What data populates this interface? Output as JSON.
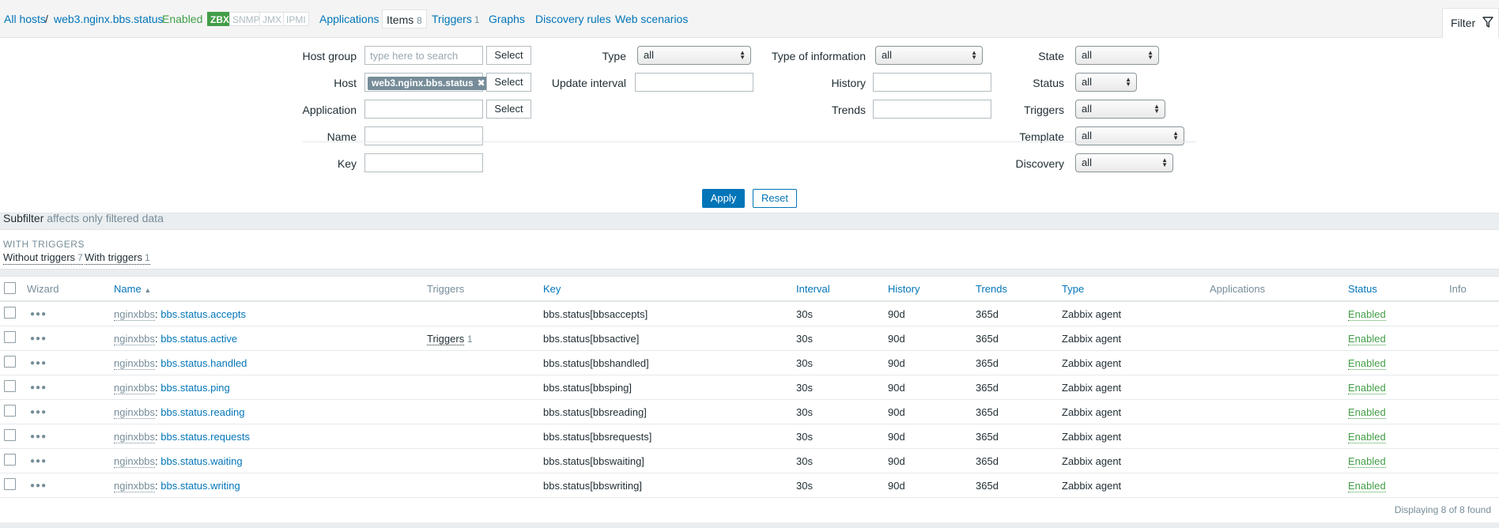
{
  "breadcrumb": {
    "all_hosts": "All hosts",
    "separator": "/",
    "host": "web3.nginx.bbs.status",
    "status": "Enabled",
    "protocols": [
      "ZBX",
      "SNMP",
      "JMX",
      "IPMI"
    ]
  },
  "tabs": [
    {
      "label": "Applications"
    },
    {
      "label": "Items",
      "count": "8"
    },
    {
      "label": "Triggers",
      "count": "1"
    },
    {
      "label": "Graphs"
    },
    {
      "label": "Discovery rules"
    },
    {
      "label": "Web scenarios"
    }
  ],
  "filter_tab": {
    "label": "Filter"
  },
  "filter": {
    "host_group": {
      "label": "Host group",
      "placeholder": "type here to search",
      "button": "Select"
    },
    "host": {
      "label": "Host",
      "chip": "web3.nginx.bbs.status",
      "button": "Select"
    },
    "application": {
      "label": "Application",
      "button": "Select"
    },
    "name": {
      "label": "Name"
    },
    "key": {
      "label": "Key"
    },
    "type": {
      "label": "Type",
      "value": "all"
    },
    "update_interval": {
      "label": "Update interval"
    },
    "type_of_information": {
      "label": "Type of information",
      "value": "all"
    },
    "history": {
      "label": "History"
    },
    "trends": {
      "label": "Trends"
    },
    "state": {
      "label": "State",
      "value": "all"
    },
    "status": {
      "label": "Status",
      "value": "all"
    },
    "triggers": {
      "label": "Triggers",
      "value": "all"
    },
    "template": {
      "label": "Template",
      "value": "all"
    },
    "discovery": {
      "label": "Discovery",
      "value": "all"
    },
    "apply": "Apply",
    "reset": "Reset"
  },
  "subfilter": {
    "title": "Subfilter",
    "note": "affects only filtered data",
    "group": "WITH TRIGGERS",
    "options": [
      {
        "label": "Without triggers",
        "count": "7"
      },
      {
        "label": "With triggers",
        "count": "1"
      }
    ]
  },
  "table": {
    "columns": {
      "wizard": "Wizard",
      "name": "Name",
      "triggers": "Triggers",
      "key": "Key",
      "interval": "Interval",
      "history": "History",
      "trends": "Trends",
      "type": "Type",
      "applications": "Applications",
      "status": "Status",
      "info": "Info"
    },
    "sort_arrow": "▲",
    "rows": [
      {
        "host": "nginxbbs",
        "name": "bbs.status.accepts",
        "triggers": "",
        "triggers_count": "",
        "key": "bbs.status[bbsaccepts]",
        "interval": "30s",
        "history": "90d",
        "trends": "365d",
        "type": "Zabbix agent",
        "status": "Enabled"
      },
      {
        "host": "nginxbbs",
        "name": "bbs.status.active",
        "triggers": "Triggers",
        "triggers_count": "1",
        "key": "bbs.status[bbsactive]",
        "interval": "30s",
        "history": "90d",
        "trends": "365d",
        "type": "Zabbix agent",
        "status": "Enabled"
      },
      {
        "host": "nginxbbs",
        "name": "bbs.status.handled",
        "triggers": "",
        "triggers_count": "",
        "key": "bbs.status[bbshandled]",
        "interval": "30s",
        "history": "90d",
        "trends": "365d",
        "type": "Zabbix agent",
        "status": "Enabled"
      },
      {
        "host": "nginxbbs",
        "name": "bbs.status.ping",
        "triggers": "",
        "triggers_count": "",
        "key": "bbs.status[bbsping]",
        "interval": "30s",
        "history": "90d",
        "trends": "365d",
        "type": "Zabbix agent",
        "status": "Enabled"
      },
      {
        "host": "nginxbbs",
        "name": "bbs.status.reading",
        "triggers": "",
        "triggers_count": "",
        "key": "bbs.status[bbsreading]",
        "interval": "30s",
        "history": "90d",
        "trends": "365d",
        "type": "Zabbix agent",
        "status": "Enabled"
      },
      {
        "host": "nginxbbs",
        "name": "bbs.status.requests",
        "triggers": "",
        "triggers_count": "",
        "key": "bbs.status[bbsrequests]",
        "interval": "30s",
        "history": "90d",
        "trends": "365d",
        "type": "Zabbix agent",
        "status": "Enabled"
      },
      {
        "host": "nginxbbs",
        "name": "bbs.status.waiting",
        "triggers": "",
        "triggers_count": "",
        "key": "bbs.status[bbswaiting]",
        "interval": "30s",
        "history": "90d",
        "trends": "365d",
        "type": "Zabbix agent",
        "status": "Enabled"
      },
      {
        "host": "nginxbbs",
        "name": "bbs.status.writing",
        "triggers": "",
        "triggers_count": "",
        "key": "bbs.status[bbswriting]",
        "interval": "30s",
        "history": "90d",
        "trends": "365d",
        "type": "Zabbix agent",
        "status": "Enabled"
      }
    ],
    "footer": "Displaying 8 of 8 found"
  }
}
